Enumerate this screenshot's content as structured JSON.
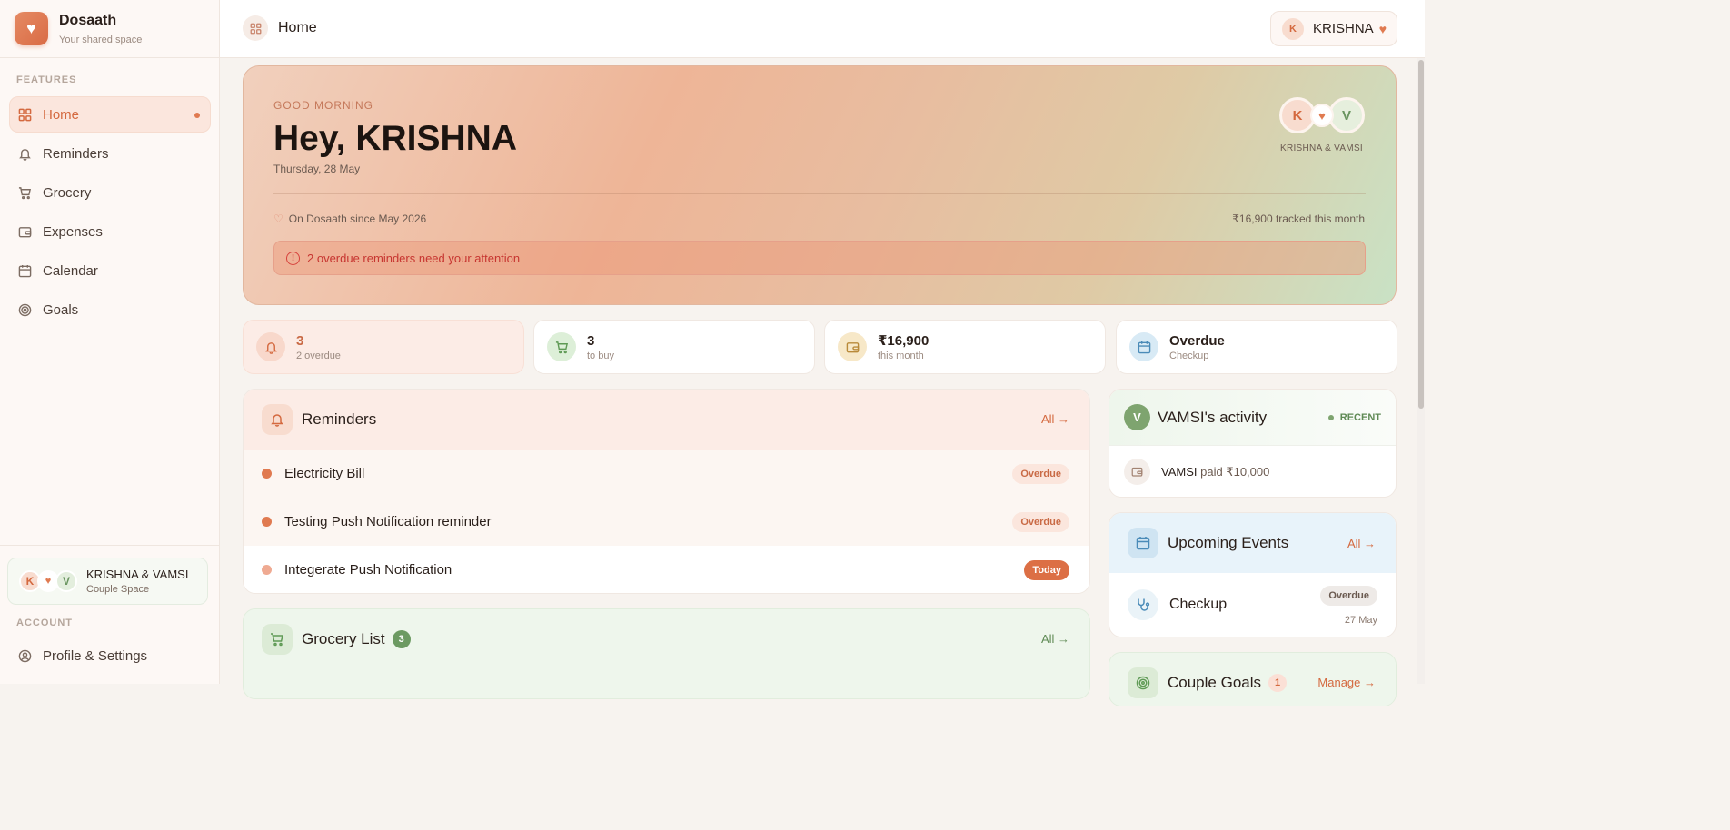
{
  "brand": {
    "name": "Dosaath",
    "tagline": "Your shared space"
  },
  "sidebar": {
    "features_label": "FEATURES",
    "items": [
      {
        "label": "Home",
        "icon": "grid-icon",
        "active": true
      },
      {
        "label": "Reminders",
        "icon": "bell-icon"
      },
      {
        "label": "Grocery",
        "icon": "cart-icon"
      },
      {
        "label": "Expenses",
        "icon": "wallet-icon"
      },
      {
        "label": "Calendar",
        "icon": "calendar-icon"
      },
      {
        "label": "Goals",
        "icon": "target-icon"
      }
    ],
    "couple": {
      "initial_a": "K",
      "initial_b": "V",
      "names": "KRISHNA & VAMSI",
      "space": "Couple Space"
    },
    "account_label": "ACCOUNT",
    "profile_label": "Profile & Settings"
  },
  "topbar": {
    "breadcrumb": "Home",
    "user_initial": "K",
    "user_name": "KRISHNA"
  },
  "hero": {
    "greeting": "GOOD MORNING",
    "title": "Hey, KRISHNA",
    "date": "Thursday, 28 May",
    "couple_label": "KRISHNA & VAMSI",
    "initial_a": "K",
    "initial_b": "V",
    "since": "On Dosaath since May 2026",
    "tracked": "₹16,900 tracked this month",
    "alert": "2 overdue reminders need your attention"
  },
  "stats": [
    {
      "value": "3",
      "label": "2 overdue",
      "icon": "bell-icon"
    },
    {
      "value": "3",
      "label": "to buy",
      "icon": "cart-icon"
    },
    {
      "value": "₹16,900",
      "label": "this month",
      "icon": "wallet-icon"
    },
    {
      "value": "Overdue",
      "label": "Checkup",
      "icon": "calendar-icon"
    }
  ],
  "reminders": {
    "title": "Reminders",
    "all_label": "All →",
    "items": [
      {
        "title": "Electricity Bill",
        "status": "Overdue"
      },
      {
        "title": "Testing Push Notification reminder",
        "status": "Overdue"
      },
      {
        "title": "Integerate Push Notification",
        "status": "Today"
      }
    ]
  },
  "grocery": {
    "title": "Grocery List",
    "count": "3",
    "all_label": "All →"
  },
  "activity": {
    "initial": "V",
    "title": "VAMSI's activity",
    "recent_label": "RECENT",
    "item_actor": "VAMSI",
    "item_text": "paid ₹10,000"
  },
  "events": {
    "title": "Upcoming Events",
    "all_label": "All →",
    "item_title": "Checkup",
    "item_status": "Overdue",
    "item_date": "27 May"
  },
  "goals": {
    "title": "Couple Goals",
    "count": "1",
    "manage_label": "Manage →"
  },
  "colors": {
    "accent": "#d4693f",
    "green": "#6c9a62",
    "alert": "#c73530"
  }
}
